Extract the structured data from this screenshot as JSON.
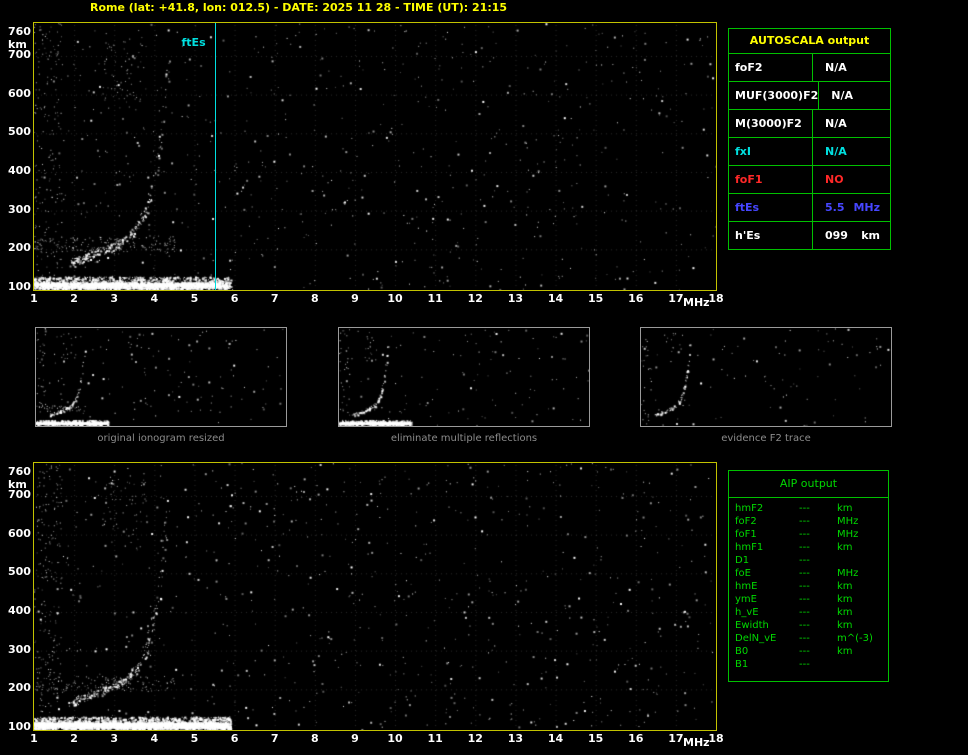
{
  "title": "Rome (lat: +41.8, lon: 012.5) - DATE: 2025 11 28 - TIME (UT): 21:15",
  "ionogram": {
    "x_ticks": [
      "1",
      "2",
      "3",
      "4",
      "5",
      "6",
      "7",
      "8",
      "9",
      "10",
      "11",
      "12",
      "13",
      "14",
      "15",
      "16",
      "17",
      "18"
    ],
    "x_unit": "MHz",
    "y_ticks": [
      "760",
      "700",
      "600",
      "500",
      "400",
      "300",
      "200",
      "100"
    ],
    "y_unit": "km",
    "ftes_label": "ftEs",
    "ftes_mhz": 5.5
  },
  "autoscala": {
    "header": "AUTOSCALA output",
    "rows": [
      {
        "label": "foF2",
        "value": "N/A",
        "unit": "",
        "color": "#ffffff"
      },
      {
        "label": "MUF(3000)F2",
        "value": "N/A",
        "unit": "",
        "color": "#ffffff"
      },
      {
        "label": "M(3000)F2",
        "value": "N/A",
        "unit": "",
        "color": "#ffffff"
      },
      {
        "label": "fxI",
        "value": "N/A",
        "unit": "",
        "color": "#00e0e0"
      },
      {
        "label": "foF1",
        "value": "NO",
        "unit": "",
        "color": "#ff2828"
      },
      {
        "label": "ftEs",
        "value": "5.5",
        "unit": "MHz",
        "color": "#4646ff"
      },
      {
        "label": "h'Es",
        "value": "099",
        "unit": "km",
        "color": "#ffffff"
      }
    ]
  },
  "thumbnails": [
    {
      "caption": "original ionogram resized"
    },
    {
      "caption": "eliminate multiple reflections"
    },
    {
      "caption": "evidence F2 trace"
    }
  ],
  "aip": {
    "header": "AIP output",
    "rows": [
      {
        "label": "hmF2",
        "value": "---",
        "unit": "km"
      },
      {
        "label": "foF2",
        "value": "---",
        "unit": "MHz"
      },
      {
        "label": "foF1",
        "value": "---",
        "unit": "MHz"
      },
      {
        "label": "hmF1",
        "value": "---",
        "unit": "km"
      },
      {
        "label": "D1",
        "value": "---",
        "unit": ""
      },
      {
        "label": "foE",
        "value": "---",
        "unit": "MHz"
      },
      {
        "label": "hmE",
        "value": "---",
        "unit": "km"
      },
      {
        "label": "ymE",
        "value": "---",
        "unit": "km"
      },
      {
        "label": "h_vE",
        "value": "---",
        "unit": "km"
      },
      {
        "label": "Ewidth",
        "value": "---",
        "unit": "km"
      },
      {
        "label": "DelN_vE",
        "value": "---",
        "unit": "m^(-3)"
      },
      {
        "label": "B0",
        "value": "---",
        "unit": "km"
      },
      {
        "label": "B1",
        "value": "---",
        "unit": ""
      }
    ]
  },
  "colors": {
    "yellow": "#ffff00",
    "plot_border_yellow": "#c2c200",
    "table_border_green": "#00c000",
    "aip_green": "#00d800",
    "cyan": "#00e0e0",
    "red": "#ff2828",
    "blue": "#4646ff",
    "caption_gray": "#8c8c8c"
  },
  "render": {
    "main_top": {
      "seed": 7,
      "grid": true,
      "noise": 700,
      "es": 1600,
      "esSolid": true,
      "mult": 160,
      "trace": 260,
      "upper": 70
    },
    "main_bottom": {
      "seed": 13,
      "grid": true,
      "noise": 750,
      "es": 2100,
      "esSolid": true,
      "mult": 140,
      "trace": 250,
      "upper": 60
    },
    "thumb1": {
      "seed": 21,
      "grid": false,
      "noise": 140,
      "es": 380,
      "esSolid": true,
      "mult": 40,
      "trace": 80,
      "upper": 15
    },
    "thumb2": {
      "seed": 22,
      "grid": false,
      "noise": 120,
      "es": 360,
      "esSolid": true,
      "mult": 0,
      "trace": 80,
      "upper": 15
    },
    "thumb3": {
      "seed": 23,
      "grid": false,
      "noise": 90,
      "es": 0,
      "esSolid": false,
      "mult": 0,
      "trace": 70,
      "upper": 12
    }
  }
}
